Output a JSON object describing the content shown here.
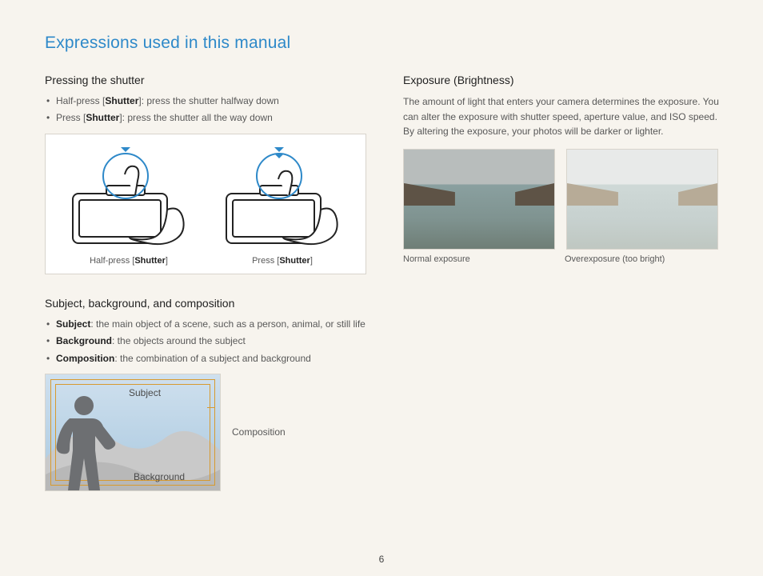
{
  "title": "Expressions used in this manual",
  "pageNumber": "6",
  "left": {
    "shutter": {
      "heading": "Pressing the shutter",
      "item1_pre": "Half-press [",
      "item1_bold": "Shutter",
      "item1_post": "]: press the shutter halfway down",
      "item2_pre": "Press [",
      "item2_bold": "Shutter",
      "item2_post": "]: press the shutter all the way down",
      "cap1_pre": "Half-press [",
      "cap1_bold": "Shutter",
      "cap1_post": "]",
      "cap2_pre": "Press [",
      "cap2_bold": "Shutter",
      "cap2_post": "]"
    },
    "composition": {
      "heading": "Subject, background, and composition",
      "subject_bold": "Subject",
      "subject_rest": ": the main object of a scene, such as a person, animal, or still life",
      "background_bold": "Background",
      "background_rest": ": the objects around the subject",
      "composition_bold": "Composition",
      "composition_rest": ": the combination of a subject and background",
      "tag_subject": "Subject",
      "tag_background": "Background",
      "label": "Composition"
    }
  },
  "right": {
    "exposure": {
      "heading": "Exposure (Brightness)",
      "para": "The amount of light that enters your camera determines the exposure. You can alter the exposure with shutter speed, aperture value, and ISO speed. By altering the exposure, your photos will be darker or lighter.",
      "cap_normal": "Normal exposure",
      "cap_over": "Overexposure (too bright)"
    }
  }
}
